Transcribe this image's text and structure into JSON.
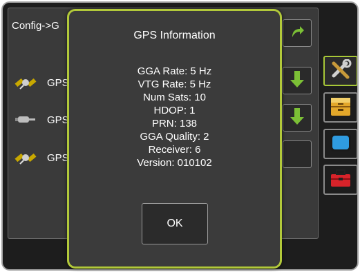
{
  "background_page": {
    "breadcrumb": "Config->G",
    "gps_rows": [
      {
        "label": "GPS",
        "icon": "satellite-icon"
      },
      {
        "label": "GPS",
        "icon": "gps-receiver-icon"
      },
      {
        "label": "GPS",
        "icon": "satellite-icon"
      }
    ],
    "side_buttons": [
      "redo-arrow-icon",
      "down-arrow-icon",
      "down-arrow-icon",
      "blank-button"
    ],
    "tool_tabs": [
      "tools-icon",
      "file-cabinet-icon",
      "display-icon",
      "toolbox-icon"
    ]
  },
  "modal": {
    "title": "GPS Information",
    "info_lines": [
      "GGA Rate: 5 Hz",
      "VTG Rate: 5 Hz",
      "Num Sats: 10",
      "HDOP: 1",
      "PRN: 138",
      "GGA Quality: 2",
      "Receiver: 6",
      "Version: 010102"
    ],
    "ok_label": "OK"
  },
  "colors": {
    "accent": "#b2c93a",
    "panel": "#3b3b3b",
    "frame": "#1d1d1d",
    "arrow_green": "#7cc036"
  }
}
